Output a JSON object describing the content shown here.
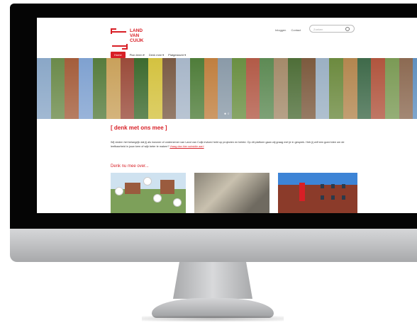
{
  "header": {
    "logo_lines": [
      "LAND",
      "VAN",
      "CUIJK"
    ],
    "top_links": [
      "Inloggen",
      "Contact"
    ],
    "search_placeholder": "Zoeken"
  },
  "nav": {
    "items": [
      {
        "label": "Home",
        "active": true
      },
      {
        "label": "Plan leren ▾",
        "active": false
      },
      {
        "label": "Denk mee ▾",
        "active": false
      },
      {
        "label": "Platgeslacht ▾",
        "active": false
      }
    ]
  },
  "banner": {
    "strip_colors": [
      "#8aa7c7",
      "#6b8a4a",
      "#a45d3b",
      "#7fa1d0",
      "#567c3d",
      "#c9a15b",
      "#9a4b3a",
      "#3d6b2f",
      "#d4c240",
      "#7a5b45",
      "#a7b6c8",
      "#4f7d3a",
      "#c07f3f",
      "#8a9aa8",
      "#6a8f42",
      "#b25a47",
      "#5d8a54",
      "#a48a6a",
      "#4e6e38",
      "#7c5a3e",
      "#9bb0c3",
      "#6c8a3f",
      "#b3864f",
      "#3f6a4a",
      "#b0553e",
      "#7b9a55",
      "#8c6a52",
      "#5f8fbf"
    ],
    "dots": "● ○"
  },
  "content": {
    "heading": "[ denk met ons mee ]",
    "intro_text": "Wij vinden het belangrijk dat jij als inwoner of ondernemer van Land van Cuijk invloed hebt op projecten en beleid. Op dit platform gaan wij graag met je in gesprek. Heb jij zelf een goed idee om de leefbaarheid in jouw kern of wijk beter te maken?",
    "intro_link": "Vraag dan hier subsidie aan!",
    "subheading": "Denk nu mee over..."
  },
  "colors": {
    "brand_red": "#d81f26",
    "bezel": "#050505",
    "chin": "#c4c5c7"
  }
}
